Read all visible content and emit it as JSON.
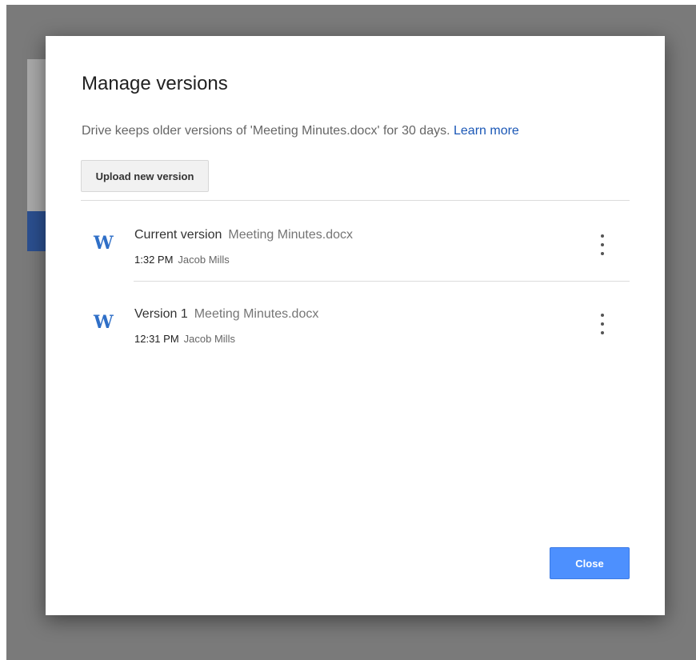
{
  "dialog": {
    "title": "Manage versions",
    "description_prefix": "Drive keeps older versions of 'Meeting Minutes.docx' for 30 days.",
    "learn_more": "Learn more",
    "upload_label": "Upload new version",
    "close_label": "Close"
  },
  "versions": [
    {
      "icon": "W",
      "label": "Current version",
      "file": "Meeting Minutes.docx",
      "time": "1:32 PM",
      "author": "Jacob Mills"
    },
    {
      "icon": "W",
      "label": "Version 1",
      "file": "Meeting Minutes.docx",
      "time": "12:31 PM",
      "author": "Jacob Mills"
    }
  ],
  "colors": {
    "accent": "#4d90fe",
    "link": "#1a57b6",
    "word_icon": "#2f6fc7"
  }
}
